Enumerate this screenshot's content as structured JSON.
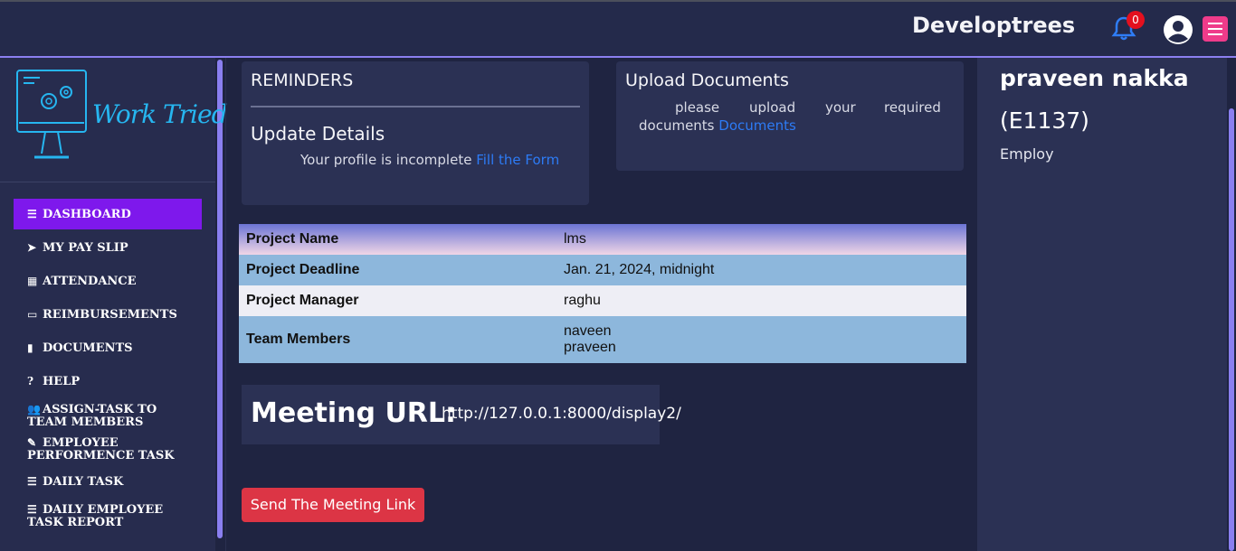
{
  "header": {
    "brand": "Developtrees",
    "notification_count": "0"
  },
  "sidebar": {
    "logo_text": "Work Tried",
    "items": [
      {
        "label": "DASHBOARD",
        "icon": "bars-icon"
      },
      {
        "label": "MY PAY SLIP",
        "icon": "paper-plane-icon"
      },
      {
        "label": "ATTENDANCE",
        "icon": "calendar-icon"
      },
      {
        "label": "REIMBURSEMENTS",
        "icon": "credit-card-icon"
      },
      {
        "label": "DOCUMENTS",
        "icon": "file-icon"
      },
      {
        "label": "HELP",
        "icon": "question-circle-icon"
      },
      {
        "label_line1": "ASSIGN-TASK TO",
        "label_line2": "TEAM MEMBERS",
        "icon": "users-icon"
      },
      {
        "label_line1": "EMPLOYEE",
        "label_line2": "PERFORMENCE TASK",
        "icon": "user-edit-icon"
      },
      {
        "label": "DAILY TASK",
        "icon": "list-check-icon"
      },
      {
        "label_line1": "DAILY EMPLOYEE",
        "label_line2": "TASK REPORT",
        "icon": "list-check-icon"
      }
    ]
  },
  "reminders": {
    "title": "REMINDERS",
    "subtitle": "Update Details",
    "text": "Your profile is incomplete",
    "link": "Fill the Form"
  },
  "upload": {
    "title": "Upload Documents",
    "text_line1_words": [
      "please",
      "upload",
      "your",
      "required"
    ],
    "text_line2": "documents",
    "link": "Documents"
  },
  "project": {
    "rows": [
      {
        "label": "Project Name",
        "value": "lms"
      },
      {
        "label": "Project Deadline",
        "value": "Jan. 21, 2024, midnight"
      },
      {
        "label": "Project Manager",
        "value": "raghu"
      },
      {
        "label": "Team Members",
        "value_line1": "naveen",
        "value_line2": "praveen"
      }
    ]
  },
  "meeting": {
    "label": "Meeting URL:",
    "url": "http://127.0.0.1:8000/display2/",
    "button": "Send The Meeting Link"
  },
  "profile": {
    "name": "praveen nakka",
    "id": "(E1137)",
    "role": "Employ"
  },
  "colors": {
    "accent": "#7e18ec",
    "link": "#2d7bf5",
    "danger": "#dc3545",
    "menu": "#ef3b8a"
  }
}
